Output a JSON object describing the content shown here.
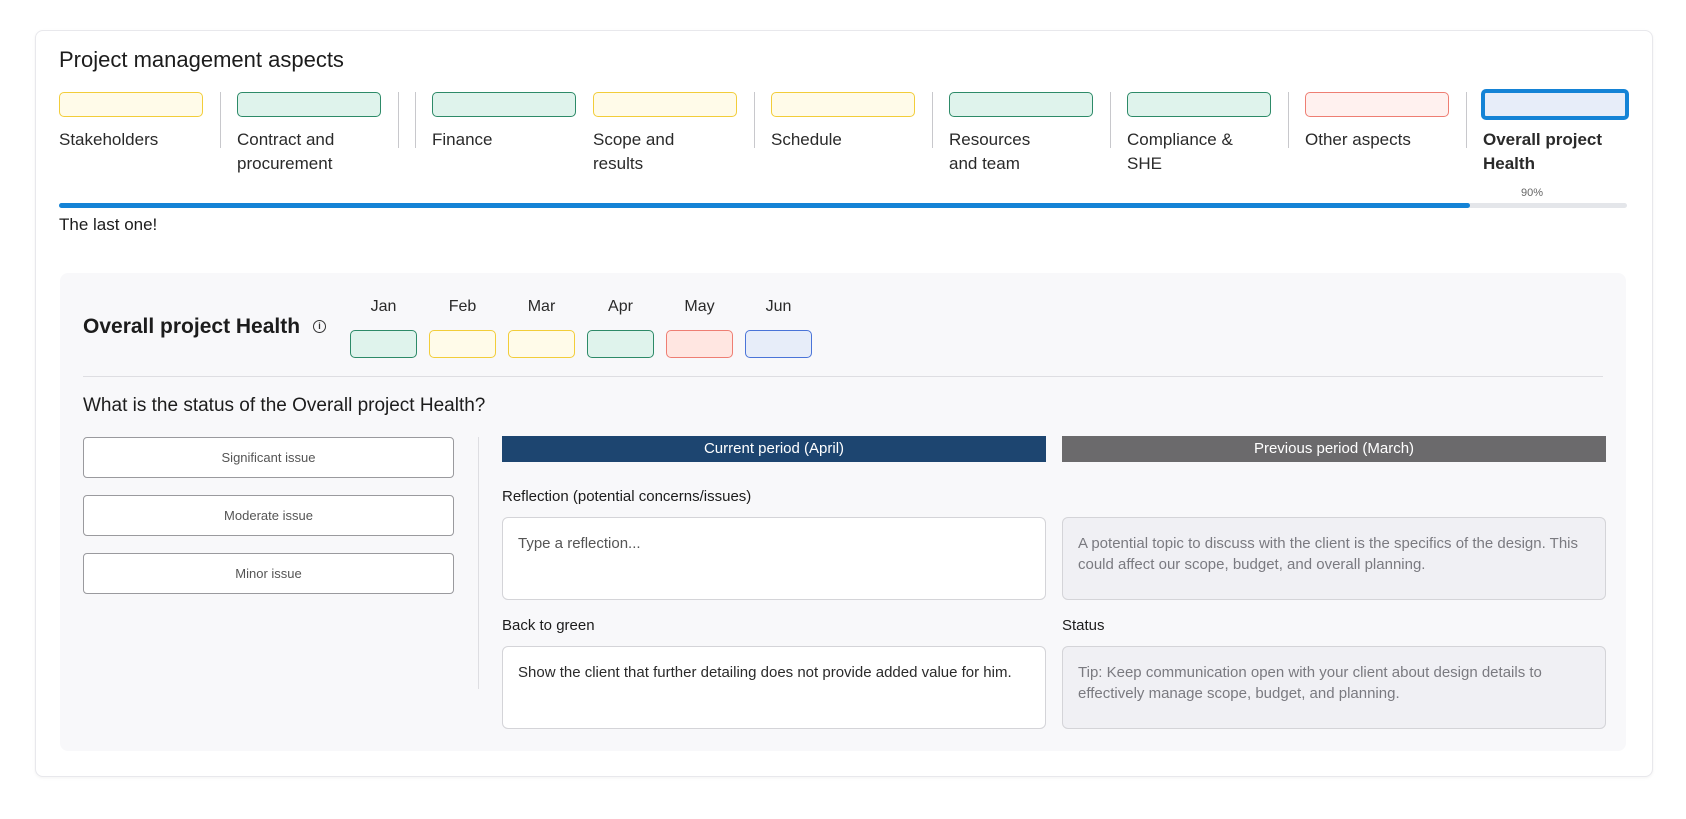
{
  "header": {
    "title": "Project management aspects"
  },
  "aspects": [
    {
      "label": "Stakeholders",
      "border": "#f2cd3a",
      "fill": "#fffbe9"
    },
    {
      "label": "Contract and procurement",
      "border": "#2d8a68",
      "fill": "#dff3ec"
    },
    {
      "label": "Finance",
      "border": "#2d8a68",
      "fill": "#dff3ec"
    },
    {
      "label": "Scope and results",
      "border": "#f2cd3a",
      "fill": "#fffbe9"
    },
    {
      "label": "Schedule",
      "border": "#f2cd3a",
      "fill": "#fffbe9"
    },
    {
      "label": "Resources and team",
      "border": "#2d8a68",
      "fill": "#dff3ec"
    },
    {
      "label": "Compliance & SHE",
      "border": "#2d8a68",
      "fill": "#dff3ec"
    },
    {
      "label": "Other aspects",
      "border": "#ee7e73",
      "fill": "#fff1ef"
    },
    {
      "label": "Overall project Health",
      "border": "#1483d6",
      "fill": "#e7edf9",
      "active": true
    }
  ],
  "progress": {
    "percent": 90,
    "label": "90%",
    "message": "The last one!"
  },
  "panel": {
    "title": "Overall project Health",
    "info_icon": "info-icon",
    "months": [
      {
        "name": "Jan",
        "border": "#2d8a68",
        "fill": "#dff3ec"
      },
      {
        "name": "Feb",
        "border": "#f2cd3a",
        "fill": "#fffbe9"
      },
      {
        "name": "Mar",
        "border": "#f2cd3a",
        "fill": "#fffbe9"
      },
      {
        "name": "Apr",
        "border": "#2d8a68",
        "fill": "#dff3ec"
      },
      {
        "name": "May",
        "border": "#ee7e73",
        "fill": "#ffe6e1"
      },
      {
        "name": "Jun",
        "border": "#4a74d8",
        "fill": "#e7edf9"
      }
    ],
    "question": "What is the status of the Overall project Health?",
    "options": [
      {
        "label": "Significant issue",
        "selected": false
      },
      {
        "label": "Moderate issue",
        "selected": false
      },
      {
        "label": "Minor issue",
        "selected": true
      }
    ],
    "current_header": "Current period (April)",
    "previous_header": "Previous period (March)",
    "reflection_label": "Reflection (potential concerns/issues)",
    "reflection_placeholder": "Type a reflection...",
    "previous_reflection": "A potential topic to discuss with the client is the specifics of the design. This could affect our scope, budget, and overall planning.",
    "back_to_green_label": "Back to green",
    "back_to_green_value": "Show the client that further detailing does not provide added value for him.",
    "status_label": "Status",
    "status_value": "Tip: Keep communication open with your client about design details to effectively manage scope, budget, and planning."
  }
}
